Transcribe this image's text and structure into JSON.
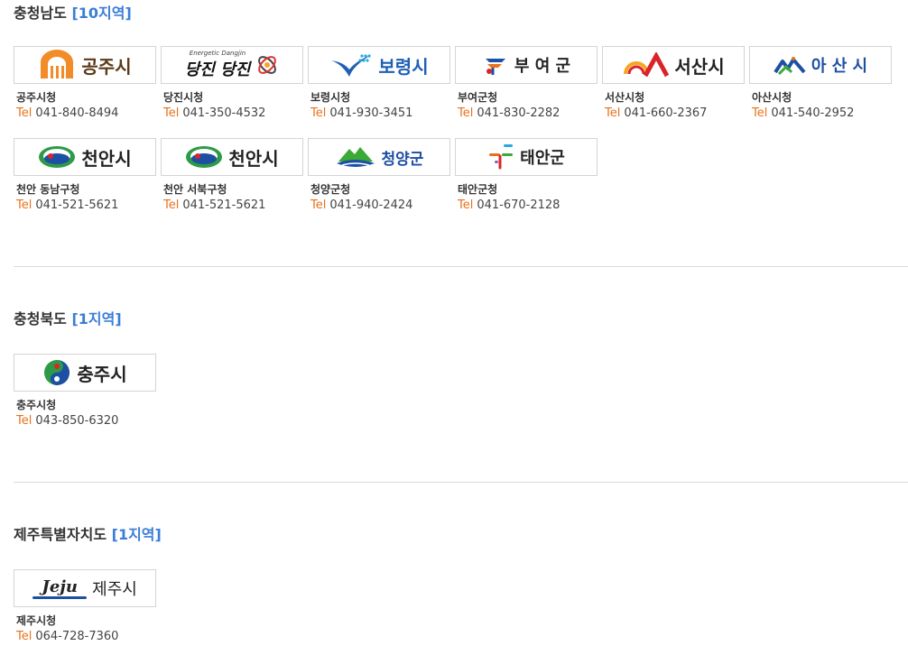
{
  "sections": [
    {
      "name": "충청남도",
      "count": "[10지역]",
      "cards": [
        {
          "logo": "공주시",
          "name": "공주시청",
          "tel_label": "Tel",
          "tel": "041-840-8494",
          "color": "#5b3a1a",
          "icon": "arch-icon"
        },
        {
          "logo": "당진 당진",
          "logo_sub": "Energetic Dangjin",
          "name": "당진시청",
          "tel_label": "Tel",
          "tel": "041-350-4532",
          "color": "#111111",
          "icon": "orbit-icon"
        },
        {
          "logo": "보령시",
          "name": "보령시청",
          "tel_label": "Tel",
          "tel": "041-930-3451",
          "color": "#1f5fb5",
          "icon": "wave-icon"
        },
        {
          "logo": "부 여 군",
          "name": "부여군청",
          "tel_label": "Tel",
          "tel": "041-830-2282",
          "color": "#222222",
          "icon": "flower-icon"
        },
        {
          "logo": "서산시",
          "name": "서산시청",
          "tel_label": "Tel",
          "tel": "041-660-2367",
          "color": "#222222",
          "icon": "sun-icon"
        },
        {
          "logo": "아 산 시",
          "name": "아산시청",
          "tel_label": "Tel",
          "tel": "041-540-2952",
          "color": "#1d4fa3",
          "icon": "mountain-icon"
        },
        {
          "logo": "천안시",
          "name": "천안 동남구청",
          "tel_label": "Tel",
          "tel": "041-521-5621",
          "color": "#222222",
          "icon": "emblem-icon"
        },
        {
          "logo": "천안시",
          "name": "천안 서북구청",
          "tel_label": "Tel",
          "tel": "041-521-5621",
          "color": "#222222",
          "icon": "emblem-icon"
        },
        {
          "logo": "청양군",
          "name": "청양군청",
          "tel_label": "Tel",
          "tel": "041-940-2424",
          "color": "#1d4fa3",
          "icon": "hill-icon"
        },
        {
          "logo": "태안군",
          "name": "태안군청",
          "tel_label": "Tel",
          "tel": "041-670-2128",
          "color": "#222222",
          "icon": "dots-icon"
        }
      ]
    },
    {
      "name": "충청북도",
      "count": "[1지역]",
      "cards": [
        {
          "logo": "충주시",
          "name": "충주시청",
          "tel_label": "Tel",
          "tel": "043-850-6320",
          "color": "#222222",
          "icon": "swirl-icon"
        }
      ]
    },
    {
      "name": "제주특별자치도",
      "count": "[1지역]",
      "cards": [
        {
          "logo": "제주시",
          "logo_prefix": "Jeju",
          "name": "제주시청",
          "tel_label": "Tel",
          "tel": "064-728-7360",
          "color": "#222222",
          "icon": "jeju-icon"
        }
      ]
    }
  ]
}
